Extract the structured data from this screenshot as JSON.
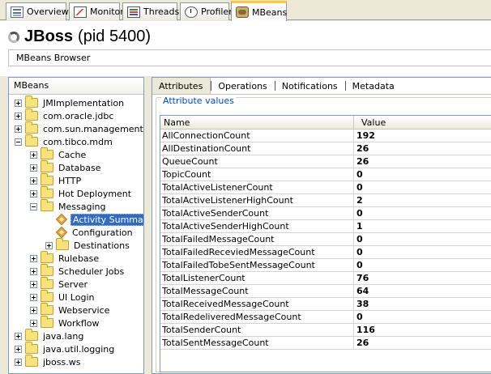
{
  "tabs": [
    {
      "label": "Overview",
      "icon": "overview-icon"
    },
    {
      "label": "Monitor",
      "icon": "monitor-icon"
    },
    {
      "label": "Threads",
      "icon": "threads-icon"
    },
    {
      "label": "Profiler",
      "icon": "profiler-icon"
    },
    {
      "label": "MBeans",
      "icon": "mbeans-icon",
      "active": true
    }
  ],
  "header": {
    "app_name": "JBoss",
    "pid_text": "(pid 5400)",
    "subtab_label": "MBeans Browser"
  },
  "tree": {
    "title": "MBeans",
    "items": [
      {
        "label": "JMImplementation",
        "level": 0,
        "expander": "plus",
        "icon": "folder-icon"
      },
      {
        "label": "com.oracle.jdbc",
        "level": 0,
        "expander": "plus",
        "icon": "folder-icon"
      },
      {
        "label": "com.sun.management",
        "level": 0,
        "expander": "plus",
        "icon": "folder-icon"
      },
      {
        "label": "com.tibco.mdm",
        "level": 0,
        "expander": "minus",
        "icon": "folder-icon"
      },
      {
        "label": "Cache",
        "level": 1,
        "expander": "plus",
        "icon": "folder-icon"
      },
      {
        "label": "Database",
        "level": 1,
        "expander": "plus",
        "icon": "folder-icon"
      },
      {
        "label": "HTTP",
        "level": 1,
        "expander": "plus",
        "icon": "folder-icon"
      },
      {
        "label": "Hot Deployment",
        "level": 1,
        "expander": "plus",
        "icon": "folder-icon"
      },
      {
        "label": "Messaging",
        "level": 1,
        "expander": "minus",
        "icon": "folder-icon"
      },
      {
        "label": "Activity Summary",
        "level": 2,
        "expander": "none",
        "icon": "bean-icon",
        "selected": true
      },
      {
        "label": "Configuration",
        "level": 2,
        "expander": "none",
        "icon": "bean-icon"
      },
      {
        "label": "Destinations",
        "level": 2,
        "expander": "plus",
        "icon": "folder-icon"
      },
      {
        "label": "Rulebase",
        "level": 1,
        "expander": "plus",
        "icon": "folder-icon"
      },
      {
        "label": "Scheduler Jobs",
        "level": 1,
        "expander": "plus",
        "icon": "folder-icon"
      },
      {
        "label": "Server",
        "level": 1,
        "expander": "plus",
        "icon": "folder-icon"
      },
      {
        "label": "UI Login",
        "level": 1,
        "expander": "plus",
        "icon": "folder-icon"
      },
      {
        "label": "Webservice",
        "level": 1,
        "expander": "plus",
        "icon": "folder-icon"
      },
      {
        "label": "Workflow",
        "level": 1,
        "expander": "plus",
        "icon": "folder-icon"
      },
      {
        "label": "java.lang",
        "level": 0,
        "expander": "plus",
        "icon": "folder-icon"
      },
      {
        "label": "java.util.logging",
        "level": 0,
        "expander": "plus",
        "icon": "folder-icon"
      },
      {
        "label": "jboss.ws",
        "level": 0,
        "expander": "plus",
        "icon": "folder-icon"
      }
    ]
  },
  "detail_tabs": [
    "Attributes",
    "Operations",
    "Notifications",
    "Metadata"
  ],
  "attributes": {
    "group_title": "Attribute values",
    "columns": {
      "name": "Name",
      "value": "Value"
    },
    "rows": [
      {
        "name": "AllConnectionCount",
        "value": "192"
      },
      {
        "name": "AllDestinationCount",
        "value": "26"
      },
      {
        "name": "QueueCount",
        "value": "26"
      },
      {
        "name": "TopicCount",
        "value": "0"
      },
      {
        "name": "TotalActiveListenerCount",
        "value": "0"
      },
      {
        "name": "TotalActiveListenerHighCount",
        "value": "2"
      },
      {
        "name": "TotalActiveSenderCount",
        "value": "0"
      },
      {
        "name": "TotalActiveSenderHighCount",
        "value": "1"
      },
      {
        "name": "TotalFailedMessageCount",
        "value": "0"
      },
      {
        "name": "TotalFailedReceviedMessageCount",
        "value": "0"
      },
      {
        "name": "TotalFailedTobeSentMessageCount",
        "value": "0"
      },
      {
        "name": "TotalListenerCount",
        "value": "76"
      },
      {
        "name": "TotalMessageCount",
        "value": "64"
      },
      {
        "name": "TotalReceivedMessageCount",
        "value": "38"
      },
      {
        "name": "TotalRedeliveredMessageCount",
        "value": "0"
      },
      {
        "name": "TotalSenderCount",
        "value": "116"
      },
      {
        "name": "TotalSentMessageCount",
        "value": "26"
      }
    ]
  }
}
